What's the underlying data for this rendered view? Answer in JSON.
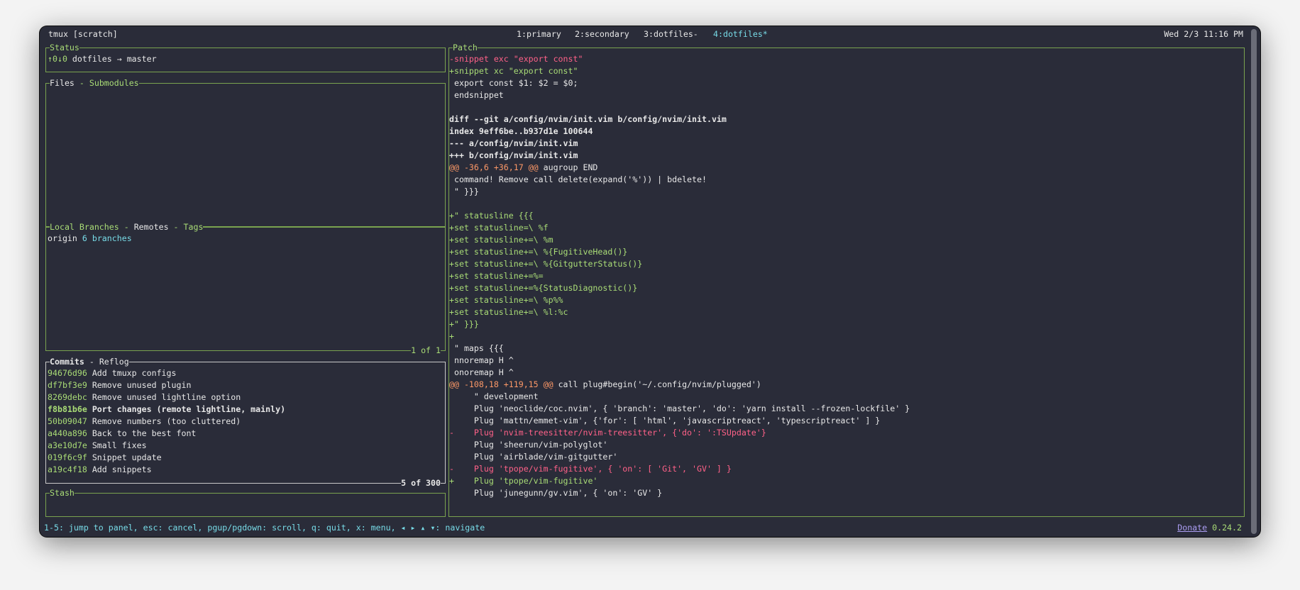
{
  "titlebar": {
    "session": "tmux [scratch]",
    "tabs": [
      {
        "label": "1:primary",
        "active": false
      },
      {
        "label": "2:secondary",
        "active": false
      },
      {
        "label": "3:dotfiles-",
        "active": false
      },
      {
        "label": "4:dotfiles*",
        "active": true
      }
    ],
    "datetime": "Wed 2/3 11:16 PM"
  },
  "status": {
    "title": "Status",
    "ahead_behind": "↑0↓0",
    "repo": "dotfiles",
    "arrow": "→",
    "branch": "master"
  },
  "files": {
    "title": "Files",
    "sep": " - ",
    "tab2": "Submodules"
  },
  "branches": {
    "tab1": "Local Branches",
    "sep1": " - ",
    "tab2": "Remotes",
    "sep2": " - ",
    "tab3": "Tags",
    "remote": "origin",
    "count": "6 branches",
    "footer": "1 of 1"
  },
  "commits": {
    "tab1": "Commits",
    "sep": " - ",
    "tab2": "Reflog",
    "items": [
      {
        "hash": "94676d96",
        "msg": "Add tmuxp configs"
      },
      {
        "hash": "df7bf3e9",
        "msg": "Remove unused plugin"
      },
      {
        "hash": "8269debc",
        "msg": "Remove unused lightline option"
      },
      {
        "hash": "f8b81b6e",
        "msg": "Port changes (remote lightline, mainly)",
        "selected": true
      },
      {
        "hash": "50b09047",
        "msg": "Remove numbers (too cluttered)"
      },
      {
        "hash": "a440a896",
        "msg": "Back to the best font"
      },
      {
        "hash": "a3e10d7e",
        "msg": "Small fixes"
      },
      {
        "hash": "019f6c9f",
        "msg": "Snippet update"
      },
      {
        "hash": "a19c4f18",
        "msg": "Add snippets"
      }
    ],
    "footer": "5 of 300"
  },
  "stash": {
    "title": "Stash"
  },
  "patch": {
    "title": "Patch",
    "lines": [
      [],
      [
        {
          "t": "-snippet exc \"export const\"",
          "c": "r"
        }
      ],
      [
        {
          "t": "+snippet xc \"export const\"",
          "c": "g"
        }
      ],
      [
        {
          "t": " export const $1: $2 = $0;",
          "c": "w"
        }
      ],
      [
        {
          "t": " endsnippet",
          "c": "w"
        }
      ],
      [],
      [
        {
          "t": "diff --git a/config/nvim/init.vim b/config/nvim/init.vim",
          "c": "w bold"
        }
      ],
      [
        {
          "t": "index 9eff6be..b937d1e 100644",
          "c": "w bold"
        }
      ],
      [
        {
          "t": "--- a/config/nvim/init.vim",
          "c": "w bold"
        }
      ],
      [
        {
          "t": "+++ b/config/nvim/init.vim",
          "c": "w bold"
        }
      ],
      [
        {
          "t": "@@ -36,6 +36,17 @@",
          "c": "o"
        },
        {
          "t": " augroup END",
          "c": "w"
        }
      ],
      [
        {
          "t": " command! Remove call delete(expand('%')) | bdelete!",
          "c": "w"
        }
      ],
      [
        {
          "t": " \" }}}",
          "c": "w"
        }
      ],
      [],
      [
        {
          "t": "+\" statusline {{{",
          "c": "g"
        }
      ],
      [
        {
          "t": "+set statusline=\\ %f",
          "c": "g"
        }
      ],
      [
        {
          "t": "+set statusline+=\\ %m",
          "c": "g"
        }
      ],
      [
        {
          "t": "+set statusline+=\\ %{FugitiveHead()}",
          "c": "g"
        }
      ],
      [
        {
          "t": "+set statusline+=\\ %{GitgutterStatus()}",
          "c": "g"
        }
      ],
      [
        {
          "t": "+set statusline+=%=",
          "c": "g"
        }
      ],
      [
        {
          "t": "+set statusline+=%{StatusDiagnostic()}",
          "c": "g"
        }
      ],
      [
        {
          "t": "+set statusline+=\\ %p%%",
          "c": "g"
        }
      ],
      [
        {
          "t": "+set statusline+=\\ %l:%c",
          "c": "g"
        }
      ],
      [
        {
          "t": "+\" }}}",
          "c": "g"
        }
      ],
      [
        {
          "t": "+",
          "c": "g"
        }
      ],
      [
        {
          "t": " \" maps {{{",
          "c": "w"
        }
      ],
      [
        {
          "t": " nnoremap H ^",
          "c": "w"
        }
      ],
      [
        {
          "t": " onoremap H ^",
          "c": "w"
        }
      ],
      [
        {
          "t": "@@ -108,18 +119,15 @@",
          "c": "o"
        },
        {
          "t": " call plug#begin('~/.config/nvim/plugged')",
          "c": "w"
        }
      ],
      [
        {
          "t": "     \" development",
          "c": "w"
        }
      ],
      [
        {
          "t": "     Plug 'neoclide/coc.nvim', { 'branch': 'master', 'do': 'yarn install --frozen-lockfile' }",
          "c": "w"
        }
      ],
      [
        {
          "t": "     Plug 'mattn/emmet-vim', {'for': [ 'html', 'javascriptreact', 'typescriptreact' ] }",
          "c": "w"
        }
      ],
      [
        {
          "t": "-    Plug 'nvim-treesitter/nvim-treesitter', {'do': ':TSUpdate'}",
          "c": "r"
        }
      ],
      [
        {
          "t": "     Plug 'sheerun/vim-polyglot'",
          "c": "w"
        }
      ],
      [
        {
          "t": "     Plug 'airblade/vim-gitgutter'",
          "c": "w"
        }
      ],
      [
        {
          "t": "-    Plug 'tpope/vim-fugitive', { 'on': [ 'Git', 'GV' ] }",
          "c": "r"
        }
      ],
      [
        {
          "t": "+    Plug 'tpope/vim-fugitive'",
          "c": "g"
        }
      ],
      [
        {
          "t": "     Plug 'junegunn/gv.vim', { 'on': 'GV' }",
          "c": "w"
        }
      ]
    ]
  },
  "footer": {
    "keybindings": "1-5: jump to panel, esc: cancel, pgup/pgdown: scroll, q: quit, x: menu, ◂ ▸ ▴ ▾: navigate",
    "donate": "Donate",
    "version": "0.24.2"
  },
  "colors": {
    "background": "#2a2c39",
    "green": "#a9dc76",
    "red": "#ff6188",
    "orange": "#fc9867",
    "blue": "#78dce8",
    "purple": "#ab9df2",
    "border": "#7aa34f"
  }
}
